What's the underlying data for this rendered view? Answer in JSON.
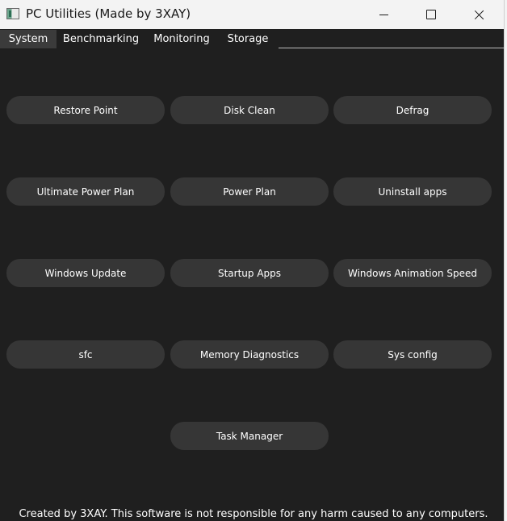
{
  "window": {
    "title": "PC Utilities (Made by 3XAY)"
  },
  "tabs": [
    {
      "label": "System",
      "active": true
    },
    {
      "label": "Benchmarking",
      "active": false
    },
    {
      "label": "Monitoring",
      "active": false
    },
    {
      "label": "Storage",
      "active": false
    }
  ],
  "buttons": {
    "restore_point": "Restore Point",
    "disk_clean": "Disk Clean",
    "defrag": "Defrag",
    "ultimate_power_plan": "Ultimate Power Plan",
    "power_plan": "Power Plan",
    "uninstall_apps": "Uninstall apps",
    "windows_update": "Windows Update",
    "startup_apps": "Startup Apps",
    "windows_animation_speed": "Windows Animation Speed",
    "sfc": "sfc",
    "memory_diagnostics": "Memory Diagnostics",
    "sys_config": "Sys config",
    "task_manager": "Task Manager"
  },
  "footer": {
    "text": "Created by 3XAY. This software is not responsible for any harm caused to any computers."
  },
  "colors": {
    "background": "#1f1f1f",
    "button": "#363636",
    "active_tab": "#3b3b3b",
    "titlebar": "#f3f3f3"
  },
  "icons": {
    "app": "app-window-icon",
    "minimize": "minimize-icon",
    "maximize": "maximize-icon",
    "close": "close-icon"
  }
}
